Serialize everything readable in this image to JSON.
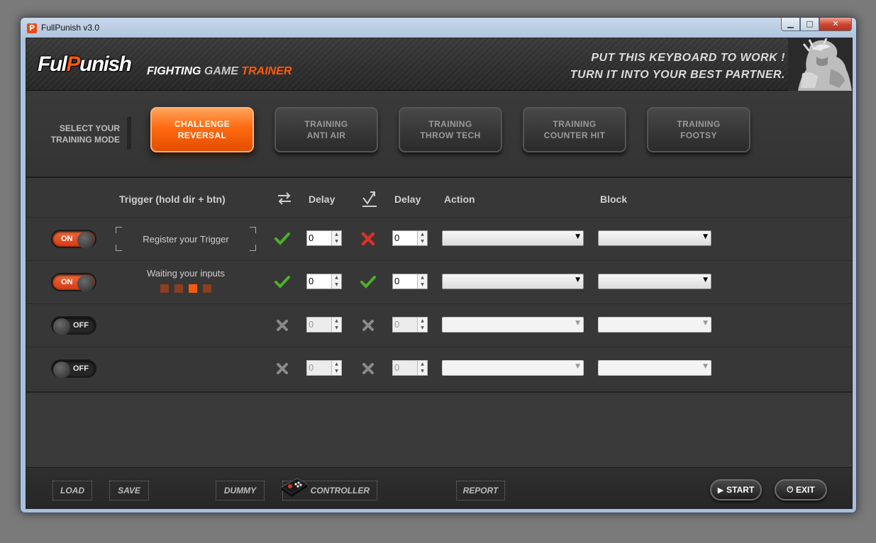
{
  "window": {
    "title": "FullPunish v3.0",
    "app_icon_letter": "P"
  },
  "header": {
    "logo": {
      "part1": "Ful",
      "part2": "P",
      "part3": "unish"
    },
    "tagline": {
      "word1": "FIGHTING",
      "word2": "GAME",
      "word3": "TRAINER"
    },
    "slogan_line1": "PUT THIS KEYBOARD TO WORK !",
    "slogan_line2": "TURN IT INTO YOUR BEST PARTNER."
  },
  "modes": {
    "label": "SELECT YOUR\nTRAINING MODE",
    "buttons": [
      {
        "label": "CHALLENGE\nREVERSAL",
        "active": true
      },
      {
        "label": "TRAINING\nANTI AIR",
        "active": false
      },
      {
        "label": "TRAINING\nTHROW TECH",
        "active": false
      },
      {
        "label": "TRAINING\nCOUNTER HIT",
        "active": false
      },
      {
        "label": "TRAINING\nFOOTSY",
        "active": false
      }
    ]
  },
  "table": {
    "headers": {
      "trigger": "Trigger (hold dir + btn)",
      "delay1": "Delay",
      "delay2": "Delay",
      "action": "Action",
      "block": "Block"
    },
    "icons": {
      "switch": "swap-arrows-icon",
      "reversal": "up-arrow-check-icon"
    },
    "rows": [
      {
        "toggle": "ON",
        "trigger_text": "Register your Trigger",
        "check1": "check",
        "delay1": "0",
        "check2": "cross-red",
        "delay2": "0",
        "action": "",
        "block": ""
      },
      {
        "toggle": "ON",
        "waiting_text": "Waiting your inputs",
        "check1": "check",
        "delay1": "0",
        "check2": "check",
        "delay2": "0",
        "action": "",
        "block": ""
      },
      {
        "toggle": "OFF",
        "check1": "cross-gray",
        "delay1": "0",
        "check2": "cross-gray",
        "delay2": "0",
        "action": "",
        "block": ""
      },
      {
        "toggle": "OFF",
        "check1": "cross-gray",
        "delay1": "0",
        "check2": "cross-gray",
        "delay2": "0",
        "action": "",
        "block": ""
      }
    ]
  },
  "footer": {
    "load": "LOAD",
    "save": "SAVE",
    "dummy": "DUMMY",
    "controller": "CONTROLLER",
    "report": "REPORT",
    "start": "START",
    "exit": "EXIT"
  },
  "colors": {
    "accent": "#ff5a0c",
    "check": "#4caf2a",
    "cross_red": "#d9302b",
    "cross_gray": "#8a8a8a"
  }
}
